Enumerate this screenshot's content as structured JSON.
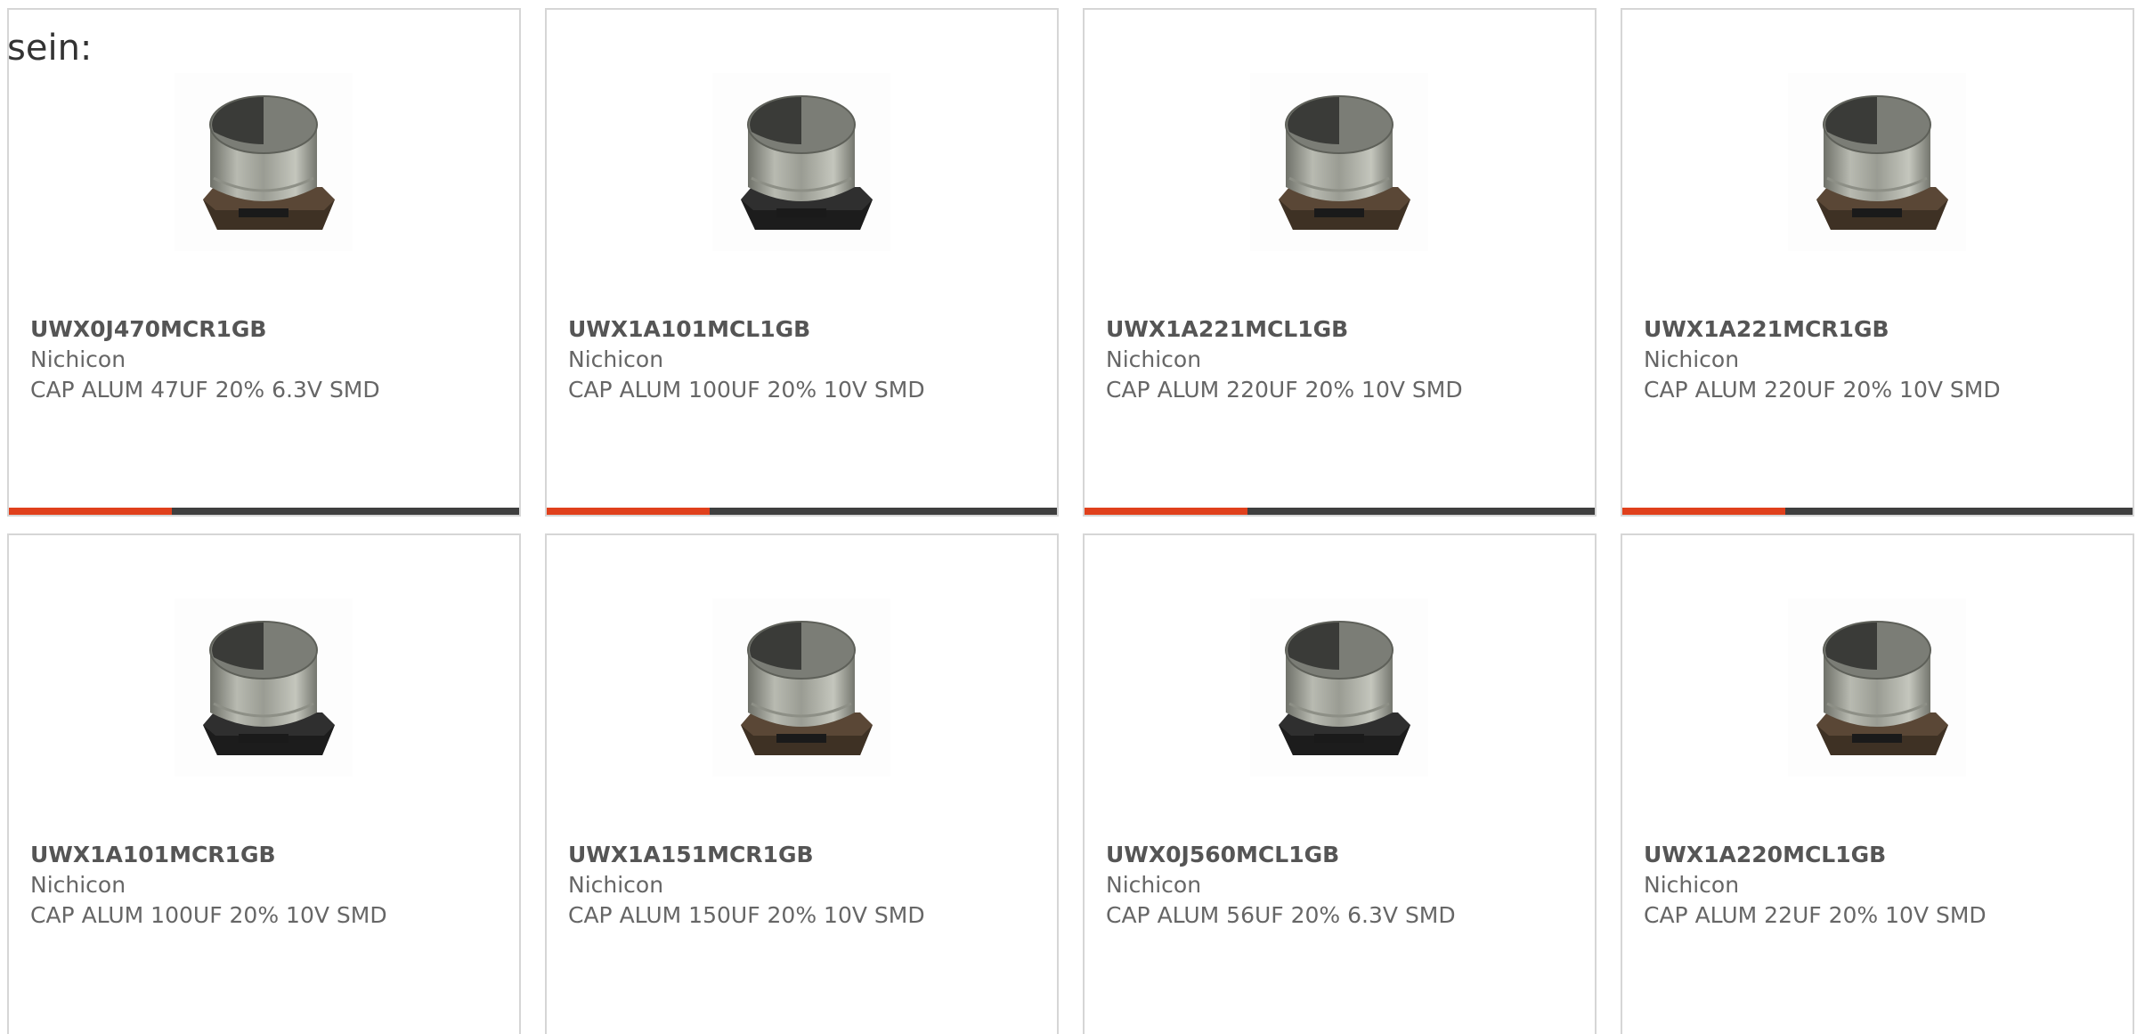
{
  "intro_text": "sein:",
  "colors": {
    "accent": "#e0401c",
    "bar_track": "#3f3f3f",
    "card_border": "#d6d6d6",
    "text": "#666666"
  },
  "products": [
    {
      "part_number": "UWX0J470MCR1GB",
      "manufacturer": "Nichicon",
      "description": "CAP ALUM 47UF 20% 6.3V SMD",
      "image_icon": "smd-capacitor-image",
      "base_color": "brown",
      "progress": 0.32
    },
    {
      "part_number": "UWX1A101MCL1GB",
      "manufacturer": "Nichicon",
      "description": "CAP ALUM 100UF 20% 10V SMD",
      "image_icon": "smd-capacitor-image",
      "base_color": "black",
      "progress": 0.32
    },
    {
      "part_number": "UWX1A221MCL1GB",
      "manufacturer": "Nichicon",
      "description": "CAP ALUM 220UF 20% 10V SMD",
      "image_icon": "smd-capacitor-image",
      "base_color": "brown",
      "progress": 0.32
    },
    {
      "part_number": "UWX1A221MCR1GB",
      "manufacturer": "Nichicon",
      "description": "CAP ALUM 220UF 20% 10V SMD",
      "image_icon": "smd-capacitor-image",
      "base_color": "brown",
      "progress": 0.32
    },
    {
      "part_number": "UWX1A101MCR1GB",
      "manufacturer": "Nichicon",
      "description": "CAP ALUM 100UF 20% 10V SMD",
      "image_icon": "smd-capacitor-image",
      "base_color": "black"
    },
    {
      "part_number": "UWX1A151MCR1GB",
      "manufacturer": "Nichicon",
      "description": "CAP ALUM 150UF 20% 10V SMD",
      "image_icon": "smd-capacitor-image",
      "base_color": "brown"
    },
    {
      "part_number": "UWX0J560MCL1GB",
      "manufacturer": "Nichicon",
      "description": "CAP ALUM 56UF 20% 6.3V SMD",
      "image_icon": "smd-capacitor-image",
      "base_color": "black"
    },
    {
      "part_number": "UWX1A220MCL1GB",
      "manufacturer": "Nichicon",
      "description": "CAP ALUM 22UF 20% 10V SMD",
      "image_icon": "smd-capacitor-image",
      "base_color": "brown"
    }
  ]
}
